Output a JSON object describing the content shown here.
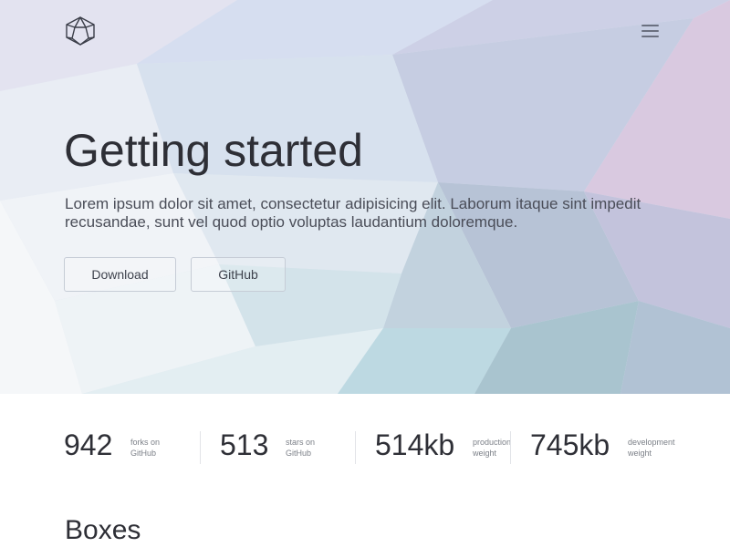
{
  "header": {
    "logo_icon": "geodesic-polyhedron-icon",
    "menu_icon": "hamburger-menu-icon"
  },
  "hero": {
    "title": "Getting started",
    "description": "Lorem ipsum dolor sit amet, consectetur adipisicing elit. Laborum itaque sint impedit recusandae, sunt vel quod optio voluptas laudantium doloremque.",
    "buttons": {
      "download": "Download",
      "github": "GitHub"
    }
  },
  "stats": [
    {
      "value": "942",
      "label_line1": "forks on",
      "label_line2": "GitHub"
    },
    {
      "value": "513",
      "label_line1": "stars on",
      "label_line2": "GitHub"
    },
    {
      "value": "514kb",
      "label_line1": "production",
      "label_line2": "weight"
    },
    {
      "value": "745kb",
      "label_line1": "development",
      "label_line2": "weight"
    }
  ],
  "sections": {
    "boxes_title": "Boxes"
  },
  "colors": {
    "text_dark": "#2e2f36",
    "text_muted": "#7c8088",
    "button_border": "#c6ccd6",
    "divider": "#e2e4e8"
  }
}
